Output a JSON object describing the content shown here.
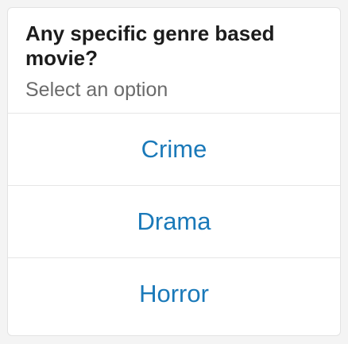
{
  "prompt": {
    "question": "Any specific genre based movie?",
    "subtitle": "Select an option"
  },
  "options": [
    {
      "label": "Crime"
    },
    {
      "label": "Drama"
    },
    {
      "label": "Horror"
    }
  ],
  "colors": {
    "option_text": "#1a79b9",
    "question_text": "#1c1c1c",
    "subtitle_text": "#6b6b6b",
    "divider": "#e6e6e6",
    "background": "#f4f4f4",
    "card": "#ffffff"
  }
}
